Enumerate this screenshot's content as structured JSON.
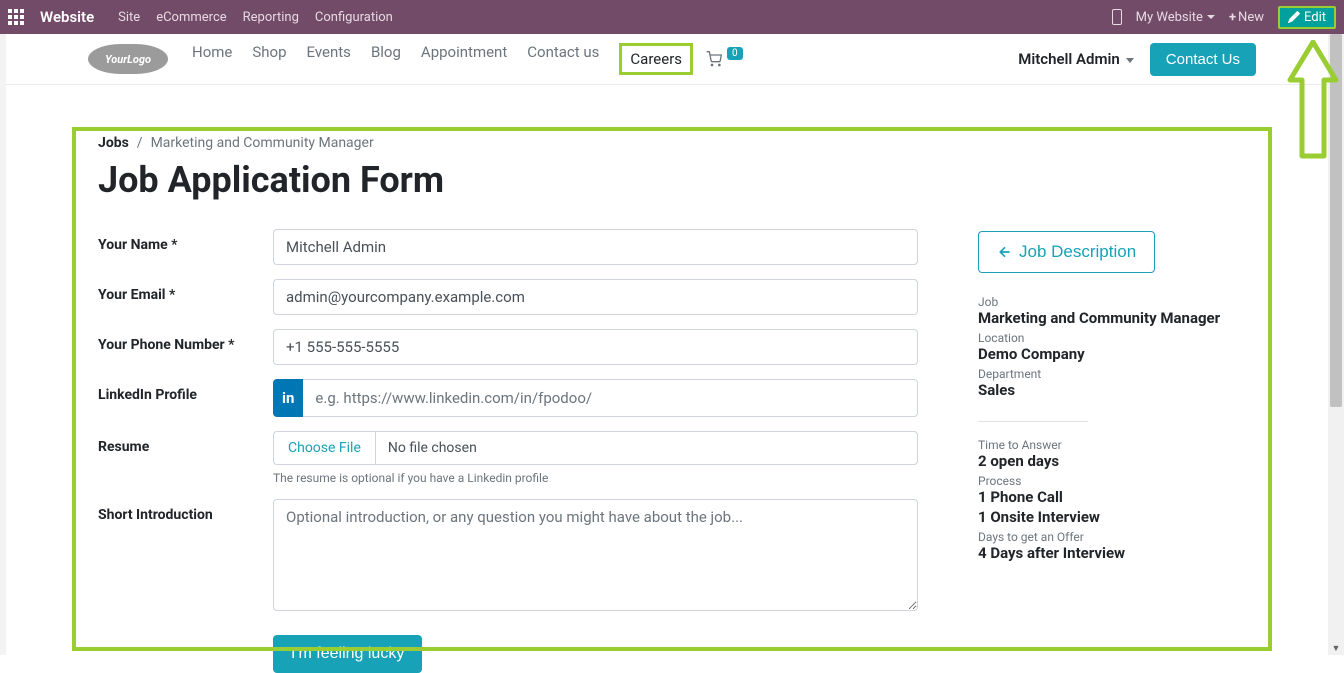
{
  "topbar": {
    "brand": "Website",
    "menu": [
      "Site",
      "eCommerce",
      "Reporting",
      "Configuration"
    ],
    "my_website": "My Website",
    "new": "New",
    "edit": "Edit"
  },
  "nav": {
    "items": [
      "Home",
      "Shop",
      "Events",
      "Blog",
      "Appointment",
      "Contact us",
      "Careers"
    ],
    "active_index": 6,
    "cart_count": "0"
  },
  "header": {
    "user": "Mitchell Admin",
    "contact_us": "Contact Us",
    "logo_text": "YourLogo"
  },
  "breadcrumb": {
    "root": "Jobs",
    "current": "Marketing and Community Manager"
  },
  "page_title": "Job Application Form",
  "form": {
    "name_label": "Your Name *",
    "name_value": "Mitchell Admin",
    "email_label": "Your Email *",
    "email_value": "admin@yourcompany.example.com",
    "phone_label": "Your Phone Number *",
    "phone_value": "+1 555-555-5555",
    "linkedin_label": "LinkedIn Profile",
    "linkedin_addon": "in",
    "linkedin_placeholder": "e.g. https://www.linkedin.com/in/fpodoo/",
    "resume_label": "Resume",
    "resume_choose": "Choose File",
    "resume_nofile": "No file chosen",
    "resume_help": "The resume is optional if you have a Linkedin profile",
    "intro_label": "Short Introduction",
    "intro_placeholder": "Optional introduction, or any question you might have about the job...",
    "submit": "I'm feeling lucky"
  },
  "sidebar": {
    "job_desc_btn": "Job Description",
    "job_label": "Job",
    "job_value": "Marketing and Community Manager",
    "location_label": "Location",
    "location_value": "Demo Company",
    "dept_label": "Department",
    "dept_value": "Sales",
    "tta_label": "Time to Answer",
    "tta_value": "2 open days",
    "process_label": "Process",
    "process_v1": "1 Phone Call",
    "process_v2": "1 Onsite Interview",
    "offer_label": "Days to get an Offer",
    "offer_value": "4 Days after Interview"
  }
}
